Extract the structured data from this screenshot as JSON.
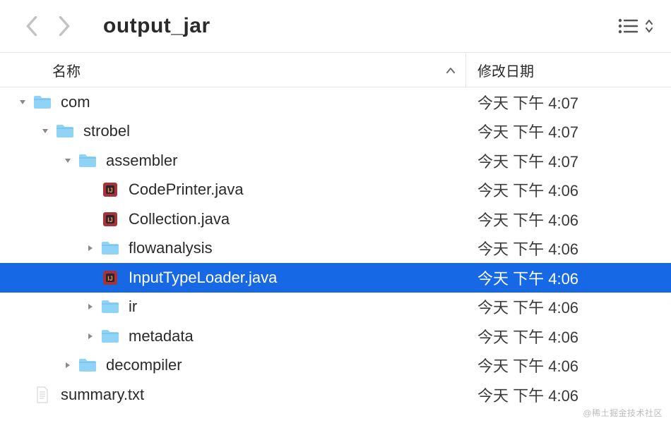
{
  "toolbar": {
    "title": "output_jar"
  },
  "columns": {
    "name": "名称",
    "date": "修改日期"
  },
  "rows": [
    {
      "indent": 0,
      "disclosure": "down",
      "icon": "folder",
      "name": "com",
      "date": "今天 下午 4:07",
      "selected": false
    },
    {
      "indent": 1,
      "disclosure": "down",
      "icon": "folder",
      "name": "strobel",
      "date": "今天 下午 4:07",
      "selected": false
    },
    {
      "indent": 2,
      "disclosure": "down",
      "icon": "folder",
      "name": "assembler",
      "date": "今天 下午 4:07",
      "selected": false
    },
    {
      "indent": 3,
      "disclosure": "none",
      "icon": "java",
      "name": "CodePrinter.java",
      "date": "今天 下午 4:06",
      "selected": false
    },
    {
      "indent": 3,
      "disclosure": "none",
      "icon": "java",
      "name": "Collection.java",
      "date": "今天 下午 4:06",
      "selected": false
    },
    {
      "indent": 3,
      "disclosure": "right",
      "icon": "folder",
      "name": "flowanalysis",
      "date": "今天 下午 4:06",
      "selected": false
    },
    {
      "indent": 3,
      "disclosure": "none",
      "icon": "java",
      "name": "InputTypeLoader.java",
      "date": "今天 下午 4:06",
      "selected": true
    },
    {
      "indent": 3,
      "disclosure": "right",
      "icon": "folder",
      "name": "ir",
      "date": "今天 下午 4:06",
      "selected": false
    },
    {
      "indent": 3,
      "disclosure": "right",
      "icon": "folder",
      "name": "metadata",
      "date": "今天 下午 4:06",
      "selected": false
    },
    {
      "indent": 2,
      "disclosure": "right",
      "icon": "folder",
      "name": "decompiler",
      "date": "今天 下午 4:06",
      "selected": false
    },
    {
      "indent": 0,
      "disclosure": "none",
      "icon": "text",
      "name": "summary.txt",
      "date": "今天 下午 4:06",
      "selected": false
    }
  ],
  "watermark": "@稀土掘金技术社区"
}
